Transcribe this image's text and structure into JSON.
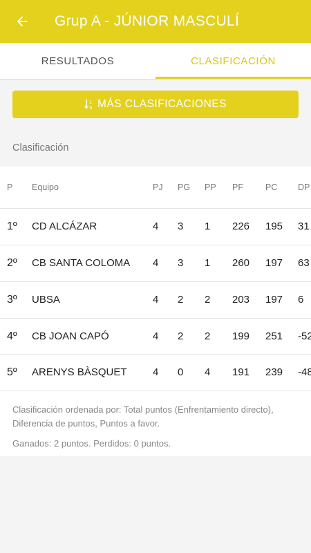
{
  "header": {
    "title": "Grup A - JÚNIOR MASCULÍ",
    "back_icon": "arrow-left-icon"
  },
  "tabs": [
    {
      "label": "RESULTADOS",
      "active": false
    },
    {
      "label": "CLASIFICACIÓN",
      "active": true
    }
  ],
  "more_button": {
    "label": "MÁS CLASIFICACIONES",
    "icon": "sort-icon"
  },
  "section_title": "Clasificación",
  "table": {
    "columns": [
      "P",
      "Equipo",
      "PJ",
      "PG",
      "PP",
      "PF",
      "PC",
      "DP"
    ],
    "rows": [
      {
        "pos": "1º",
        "team": "CD ALCÁZAR",
        "pj": "4",
        "pg": "3",
        "pp": "1",
        "pf": "226",
        "pc": "195",
        "dp": "31"
      },
      {
        "pos": "2º",
        "team": "CB SANTA COLOMA",
        "pj": "4",
        "pg": "3",
        "pp": "1",
        "pf": "260",
        "pc": "197",
        "dp": "63"
      },
      {
        "pos": "3º",
        "team": "UBSA",
        "pj": "4",
        "pg": "2",
        "pp": "2",
        "pf": "203",
        "pc": "197",
        "dp": "6"
      },
      {
        "pos": "4º",
        "team": "CB JOAN CAPÓ",
        "pj": "4",
        "pg": "2",
        "pp": "2",
        "pf": "199",
        "pc": "251",
        "dp": "-52"
      },
      {
        "pos": "5º",
        "team": "ARENYS BÀSQUET",
        "pj": "4",
        "pg": "0",
        "pp": "4",
        "pf": "191",
        "pc": "239",
        "dp": "-48"
      }
    ]
  },
  "notes": {
    "order": "Clasificación ordenada por: Total puntos (Enfrentamiento directo), Diferencia de puntos, Puntos a favor.",
    "points": "Ganados: 2 puntos. Perdidos: 0 puntos."
  },
  "colors": {
    "accent": "#e3d11e",
    "background": "#f4f4f4"
  }
}
